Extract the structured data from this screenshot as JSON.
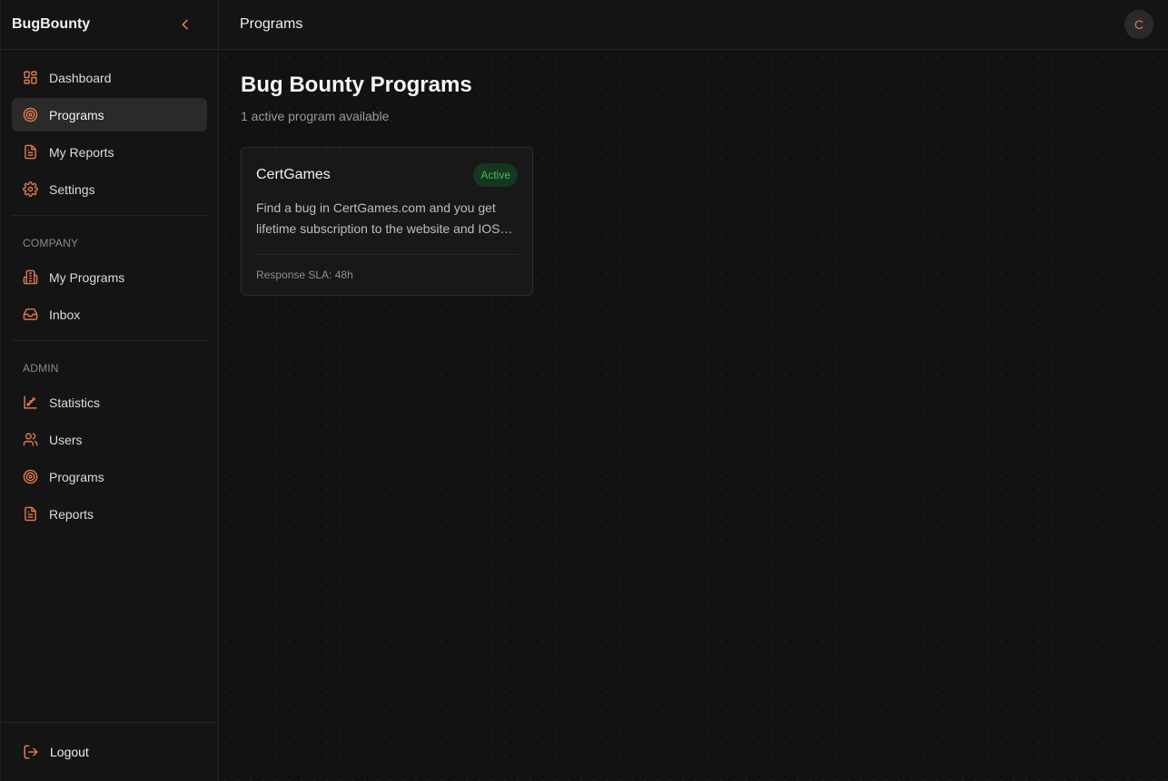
{
  "sidebar": {
    "brand": "BugBounty",
    "collapse_icon": "chevron-left-icon",
    "main_items": [
      {
        "label": "Dashboard",
        "icon": "dashboard-icon"
      },
      {
        "label": "Programs",
        "icon": "target-icon",
        "active": true
      },
      {
        "label": "My Reports",
        "icon": "file-text-icon"
      },
      {
        "label": "Settings",
        "icon": "gear-icon"
      }
    ],
    "company_label": "COMPANY",
    "company_items": [
      {
        "label": "My Programs",
        "icon": "building-icon"
      },
      {
        "label": "Inbox",
        "icon": "inbox-icon"
      }
    ],
    "admin_label": "ADMIN",
    "admin_items": [
      {
        "label": "Statistics",
        "icon": "chart-icon"
      },
      {
        "label": "Users",
        "icon": "users-icon"
      },
      {
        "label": "Programs",
        "icon": "target-icon"
      },
      {
        "label": "Reports",
        "icon": "file-text-icon"
      }
    ],
    "logout_label": "Logout"
  },
  "header": {
    "title": "Programs",
    "avatar_initial": "C"
  },
  "main": {
    "title": "Bug Bounty Programs",
    "subtitle": "1 active program available",
    "programs": [
      {
        "name": "CertGames",
        "status": "Active",
        "description": "Find a bug in CertGames.com and you get lifetime subscription to the website and IOS app",
        "sla": "Response SLA: 48h"
      }
    ]
  },
  "colors": {
    "accent": "#e07a4f",
    "active_badge_bg": "#15361f",
    "active_badge_text": "#3fbf5f",
    "background": "#121212"
  }
}
